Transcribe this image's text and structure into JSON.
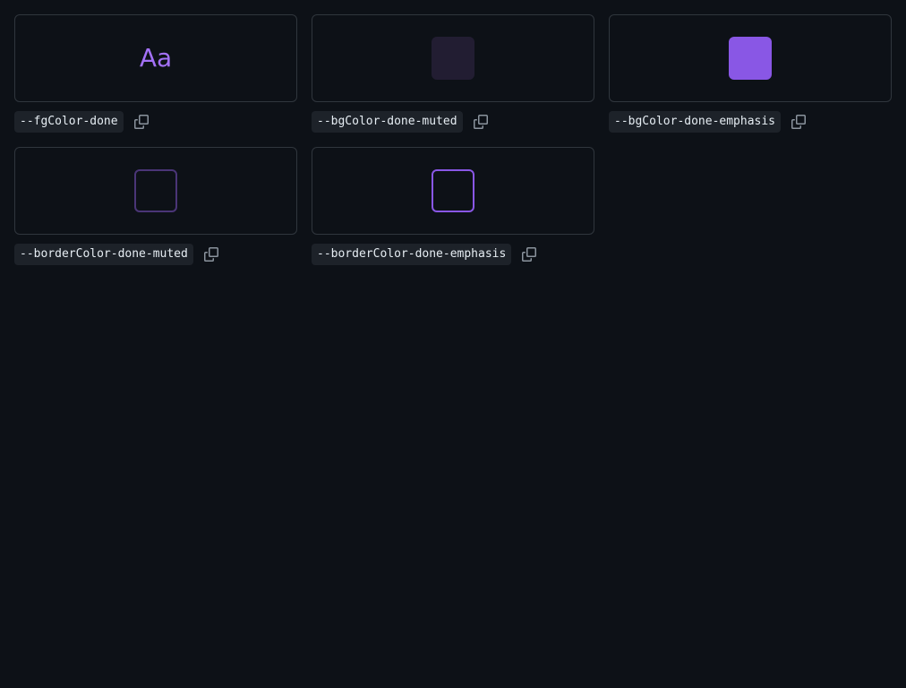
{
  "colors": {
    "page_bg": "#0d1117",
    "card_border": "#30363d",
    "label_bg": "#1d2229",
    "label_text": "#e6edf3",
    "icon": "#8b949e"
  },
  "tokens": [
    {
      "name": "--fgColor-done",
      "preview_type": "text",
      "preview_text": "Aa",
      "color": "#a371f7",
      "copy_icon": "copy-icon"
    },
    {
      "name": "--bgColor-done-muted",
      "preview_type": "fill",
      "color": "#221d32",
      "copy_icon": "copy-icon"
    },
    {
      "name": "--bgColor-done-emphasis",
      "preview_type": "fill",
      "color": "#8957e5",
      "copy_icon": "copy-icon"
    },
    {
      "name": "--borderColor-done-muted",
      "preview_type": "border",
      "color": "#4a3577",
      "copy_icon": "copy-icon"
    },
    {
      "name": "--borderColor-done-emphasis",
      "preview_type": "border",
      "color": "#8957e5",
      "copy_icon": "copy-icon"
    }
  ]
}
